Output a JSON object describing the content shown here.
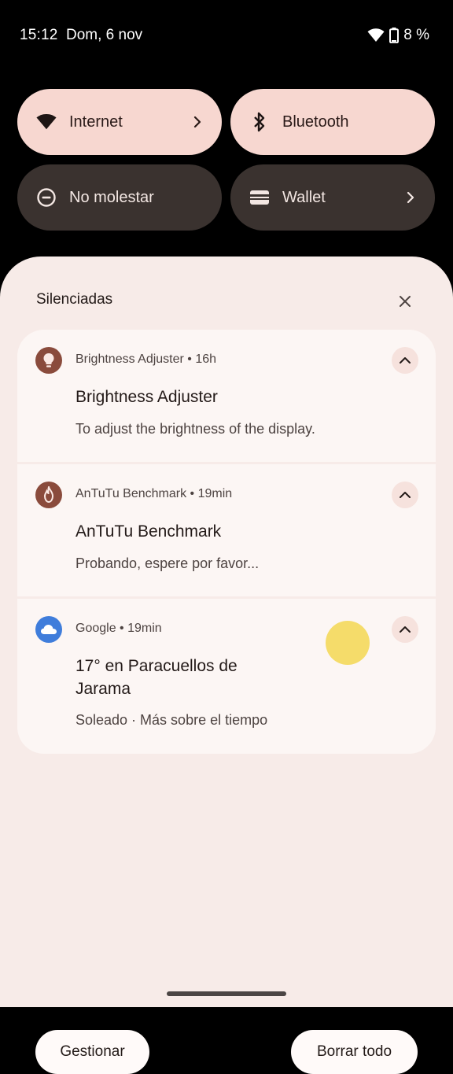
{
  "status_bar": {
    "time": "15:12",
    "date": "Dom, 6 nov",
    "battery": "8 %",
    "icons": [
      "wifi-icon",
      "battery-icon"
    ]
  },
  "quick_settings": {
    "tiles": [
      {
        "label": "Internet",
        "icon": "wifi-icon",
        "active": true,
        "has_chevron": true
      },
      {
        "label": "Bluetooth",
        "icon": "bluetooth-icon",
        "active": true,
        "has_chevron": false
      },
      {
        "label": "No molestar",
        "icon": "do-not-disturb-icon",
        "active": false,
        "has_chevron": false
      },
      {
        "label": "Wallet",
        "icon": "wallet-icon",
        "active": false,
        "has_chevron": true
      }
    ]
  },
  "shade": {
    "section_title": "Silenciadas",
    "notifications": [
      {
        "app": "Brightness Adjuster",
        "time": "16h",
        "meta": "Brightness Adjuster • 16h",
        "title": "Brightness Adjuster",
        "body": "To adjust the brightness of the display.",
        "icon": "lightbulb-icon",
        "icon_color": "#8a4b3c"
      },
      {
        "app": "AnTuTu Benchmark",
        "time": "19min",
        "meta": "AnTuTu Benchmark • 19min",
        "title": "AnTuTu Benchmark",
        "body": "Probando, espere por favor...",
        "icon": "flame-icon",
        "icon_color": "#8a4b3c"
      },
      {
        "app": "Google",
        "time": "19min",
        "meta": "Google • 19min",
        "title": "17° en Paracuellos de Jarama",
        "body": "Soleado · Más sobre el tiempo",
        "icon": "cloud-icon",
        "icon_color": "#3f7ddb"
      }
    ],
    "manage_label": "Gestionar",
    "clear_all_label": "Borrar todo"
  },
  "colors": {
    "tile_active": "#f7d7d0",
    "tile_inactive": "#3a322f",
    "shade_bg": "#f7ebe8",
    "card_bg": "#fcf6f4",
    "touch_indicator": "#f5dc6a"
  }
}
